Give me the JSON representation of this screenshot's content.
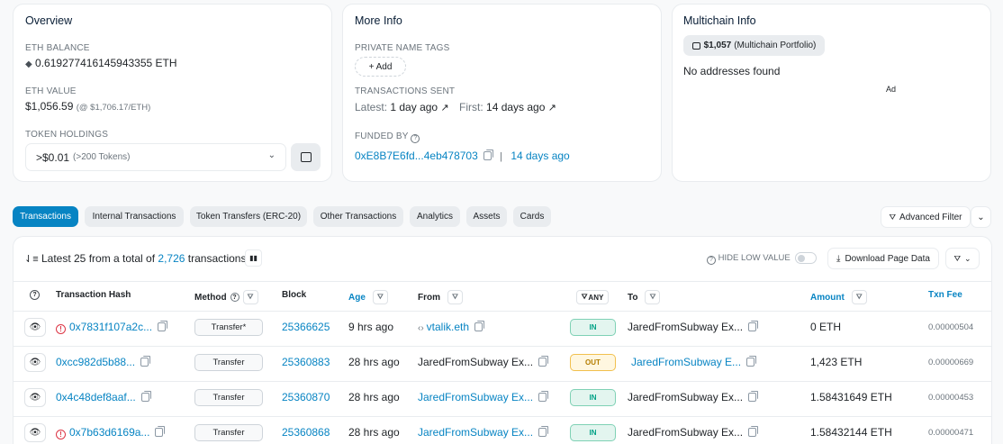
{
  "overview": {
    "title": "Overview",
    "eth_balance_label": "ETH BALANCE",
    "eth_balance": "0.619277416145943355 ETH",
    "eth_value_label": "ETH VALUE",
    "eth_value": "$1,056.59",
    "eth_price": "(@ $1,706.17/ETH)",
    "token_holdings_label": "TOKEN HOLDINGS",
    "token_value": ">$0.01",
    "token_count": "(>200 Tokens)"
  },
  "more_info": {
    "title": "More Info",
    "private_tags_label": "PRIVATE NAME TAGS",
    "add_label": "+ Add",
    "tx_sent_label": "TRANSACTIONS SENT",
    "latest_label": "Latest:",
    "latest_value": "1 day ago",
    "first_label": "First:",
    "first_value": "14 days ago",
    "funded_by_label": "FUNDED BY",
    "funded_address": "0xE8B7E6fd...4eb478703",
    "funded_age": "14 days ago",
    "separator": "|"
  },
  "multichain": {
    "title": "Multichain Info",
    "portfolio_value": "$1,057",
    "portfolio_label": "(Multichain Portfolio)",
    "no_addresses": "No addresses found",
    "ad_label": "Ad"
  },
  "tabs": [
    "Transactions",
    "Internal Transactions",
    "Token Transfers (ERC-20)",
    "Other Transactions",
    "Analytics",
    "Assets",
    "Cards"
  ],
  "toolbar": {
    "advanced_filter": "Advanced Filter",
    "summary_prefix": "Latest 25 from a total of",
    "summary_count": "2,726",
    "summary_suffix": "transactions",
    "hide_low_value": "HIDE LOW VALUE",
    "download": "Download Page Data"
  },
  "table": {
    "headers": {
      "hash": "Transaction Hash",
      "method": "Method",
      "block": "Block",
      "age": "Age",
      "from": "From",
      "any": "ANY",
      "to": "To",
      "amount": "Amount",
      "fee": "Txn Fee"
    },
    "rows": [
      {
        "hash": "0x7831f107a2c...",
        "error": true,
        "method": "Transfer*",
        "block": "25366625",
        "age": "9 hrs ago",
        "from": "vtalik.eth",
        "from_link": true,
        "direction": "IN",
        "to": "JaredFromSubway Ex...",
        "to_link": false,
        "amount": "0 ETH",
        "fee": "0.00000504"
      },
      {
        "hash": "0xcc982d5b88...",
        "error": false,
        "method": "Transfer",
        "block": "25360883",
        "age": "28 hrs ago",
        "from": "JaredFromSubway Ex...",
        "from_link": false,
        "direction": "OUT",
        "to": "JaredFromSubway E...",
        "to_link": true,
        "amount": "1,423 ETH",
        "fee": "0.00000669"
      },
      {
        "hash": "0x4c48def8aaf...",
        "error": false,
        "method": "Transfer",
        "block": "25360870",
        "age": "28 hrs ago",
        "from": "JaredFromSubway Ex...",
        "from_link": true,
        "direction": "IN",
        "to": "JaredFromSubway Ex...",
        "to_link": false,
        "amount": "1.58431649 ETH",
        "fee": "0.00000453"
      },
      {
        "hash": "0x7b63d6169a...",
        "error": true,
        "method": "Transfer",
        "block": "25360868",
        "age": "28 hrs ago",
        "from": "JaredFromSubway Ex...",
        "from_link": true,
        "direction": "IN",
        "to": "JaredFromSubway Ex...",
        "to_link": false,
        "amount": "1.58432144 ETH",
        "fee": "0.00000471"
      }
    ]
  }
}
